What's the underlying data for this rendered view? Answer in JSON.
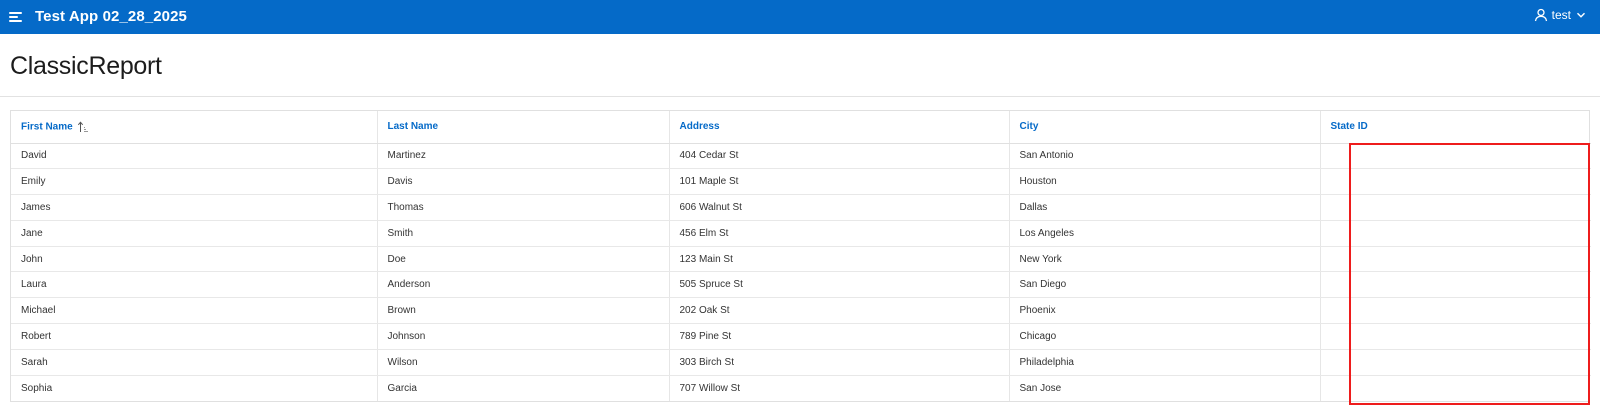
{
  "header": {
    "app_title": "Test App 02_28_2025",
    "user_label": "test"
  },
  "page": {
    "title": "ClassicReport"
  },
  "report": {
    "columns": [
      "First Name",
      "Last Name",
      "Address",
      "City",
      "State ID"
    ],
    "sorted_column": "First Name",
    "sort_direction": "ascending",
    "rows": [
      [
        "David",
        "Martinez",
        "404 Cedar St",
        "San Antonio",
        ""
      ],
      [
        "Emily",
        "Davis",
        "101 Maple St",
        "Houston",
        ""
      ],
      [
        "James",
        "Thomas",
        "606 Walnut St",
        "Dallas",
        ""
      ],
      [
        "Jane",
        "Smith",
        "456 Elm St",
        "Los Angeles",
        ""
      ],
      [
        "John",
        "Doe",
        "123 Main St",
        "New York",
        ""
      ],
      [
        "Laura",
        "Anderson",
        "505 Spruce St",
        "San Diego",
        ""
      ],
      [
        "Michael",
        "Brown",
        "202 Oak St",
        "Phoenix",
        ""
      ],
      [
        "Robert",
        "Johnson",
        "789 Pine St",
        "Chicago",
        ""
      ],
      [
        "Sarah",
        "Wilson",
        "303 Birch St",
        "Philadelphia",
        ""
      ],
      [
        "Sophia",
        "Garcia",
        "707 Willow St",
        "San Jose",
        ""
      ]
    ]
  },
  "colors": {
    "header_bg": "#056ac8",
    "link": "#056ac8",
    "highlight": "#ee1c1c"
  },
  "icons": {
    "menu": "hamburger-menu-icon",
    "user": "user-icon",
    "dropdown": "chevron-down-icon",
    "sort": "sort-ascending-icon"
  }
}
